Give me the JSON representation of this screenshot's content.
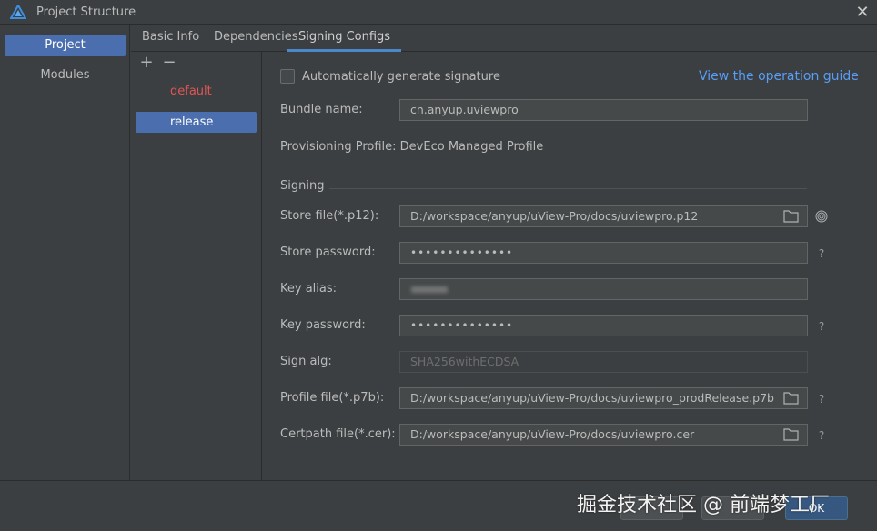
{
  "window": {
    "title": "Project Structure",
    "close_icon": "close-icon",
    "app_icon": "deveco-logo-icon"
  },
  "nav": {
    "items": [
      {
        "label": "Project",
        "active": true
      },
      {
        "label": "Modules",
        "active": false
      }
    ]
  },
  "tabs": [
    {
      "label": "Basic Info"
    },
    {
      "label": "Dependencies"
    },
    {
      "label": "Signing Configs",
      "active": true
    }
  ],
  "config_list": {
    "add_label": "+",
    "remove_label": "−",
    "items": [
      {
        "label": "default"
      },
      {
        "label": "release",
        "selected": true
      }
    ]
  },
  "form": {
    "auto_sign_label": "Automatically generate signature",
    "auto_sign_checked": false,
    "guide_link": "View the operation guide",
    "bundle_name_label": "Bundle name:",
    "bundle_name_value": "cn.anyup.uviewpro",
    "provisioning_label": "Provisioning Profile: DevEco Managed Profile",
    "provisioning_help": "?",
    "signing_section": "Signing",
    "store_file_label": "Store file(*.p12):",
    "store_file_value": "D:/workspace/anyup/uView-Pro/docs/uviewpro.p12",
    "store_password_label": "Store password:",
    "store_password_value": "••••••••••••••",
    "store_password_help": "?",
    "key_alias_label": "Key alias:",
    "key_alias_value": "",
    "key_password_label": "Key password:",
    "key_password_value": "••••••••••••••",
    "key_password_help": "?",
    "sign_alg_label": "Sign alg:",
    "sign_alg_value": "SHA256withECDSA",
    "profile_file_label": "Profile file(*.p7b):",
    "profile_file_value": "D:/workspace/anyup/uView-Pro/docs/uviewpro_prodRelease.p7b",
    "profile_file_help": "?",
    "certpath_label": "Certpath file(*.cer):",
    "certpath_value": "D:/workspace/anyup/uView-Pro/docs/uviewpro.cer",
    "certpath_help": "?"
  },
  "footer": {
    "ok_label": "OK",
    "watermark": "掘金技术社区 @ 前端梦工厂"
  },
  "colors": {
    "accent": "#4b6eaf",
    "link": "#589df6",
    "default_config": "#e05555",
    "background": "#3c3f41"
  }
}
